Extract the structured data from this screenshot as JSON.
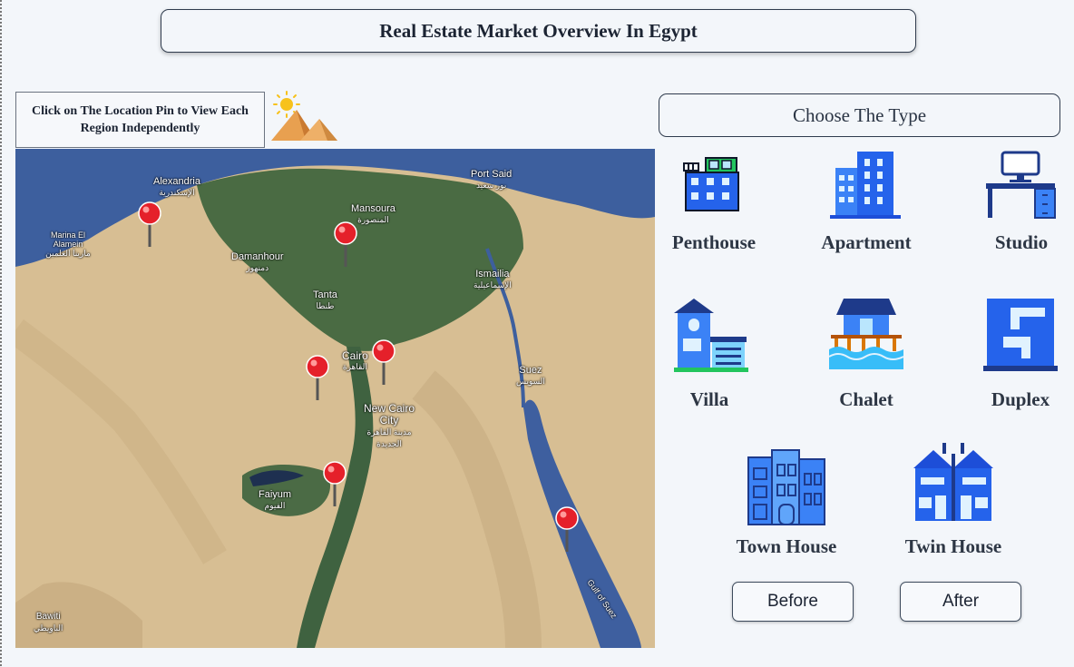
{
  "header": {
    "title": "Real Estate Market Overview In Egypt"
  },
  "map_panel": {
    "hint": "Click on The Location Pin to View Each Region Independently",
    "pyramid_icon": "pyramid-sun-icon",
    "places": [
      {
        "key": "alexandria",
        "en": "Alexandria",
        "ar": "الإسكندرية"
      },
      {
        "key": "marina",
        "en": "Marina El Alamein",
        "ar": "مارينا العلمين"
      },
      {
        "key": "mansoura",
        "en": "Mansoura",
        "ar": "المنصورة"
      },
      {
        "key": "port_said",
        "en": "Port Said",
        "ar": "بور سعيد"
      },
      {
        "key": "damanhour",
        "en": "Damanhour",
        "ar": "دمنهور"
      },
      {
        "key": "tanta",
        "en": "Tanta",
        "ar": "طنطا"
      },
      {
        "key": "ismailia",
        "en": "Ismailia",
        "ar": "الإسماعيلية"
      },
      {
        "key": "cairo",
        "en": "Cairo",
        "ar": "القاهرة"
      },
      {
        "key": "suez",
        "en": "Suez",
        "ar": "السويس"
      },
      {
        "key": "new_cairo",
        "en": "New Cairo City",
        "ar": "مدينة القاهرة الجديدة"
      },
      {
        "key": "faiyum",
        "en": "Faiyum",
        "ar": "الفيوم"
      },
      {
        "key": "bawiti",
        "en": "Bawiti",
        "ar": "الباويطي"
      },
      {
        "key": "gulf",
        "en": "Gulf of Suez",
        "ar": ""
      }
    ],
    "pins": [
      "alexandria-pin",
      "mansoura-pin",
      "giza-pin",
      "cairo-pin",
      "faiyum-pin",
      "red-sea-pin"
    ]
  },
  "types_panel": {
    "heading": "Choose The Type",
    "types": [
      {
        "key": "penthouse",
        "label": "Penthouse",
        "icon": "penthouse-icon"
      },
      {
        "key": "apartment",
        "label": "Apartment",
        "icon": "apartment-icon"
      },
      {
        "key": "studio",
        "label": "Studio",
        "icon": "studio-icon"
      },
      {
        "key": "villa",
        "label": "Villa",
        "icon": "villa-icon"
      },
      {
        "key": "chalet",
        "label": "Chalet",
        "icon": "chalet-icon"
      },
      {
        "key": "duplex",
        "label": "Duplex",
        "icon": "duplex-icon"
      },
      {
        "key": "town_house",
        "label": "Town House",
        "icon": "town-house-icon"
      },
      {
        "key": "twin_house",
        "label": "Twin House",
        "icon": "twin-house-icon"
      }
    ],
    "buttons": {
      "before": "Before",
      "after": "After"
    }
  },
  "colors": {
    "background": "#f3f6fa",
    "pin": "#e5202a",
    "icon_blue": "#2563eb",
    "sea": "#3b63a8",
    "delta": "#4f6e45",
    "desert": "#d8c096"
  }
}
